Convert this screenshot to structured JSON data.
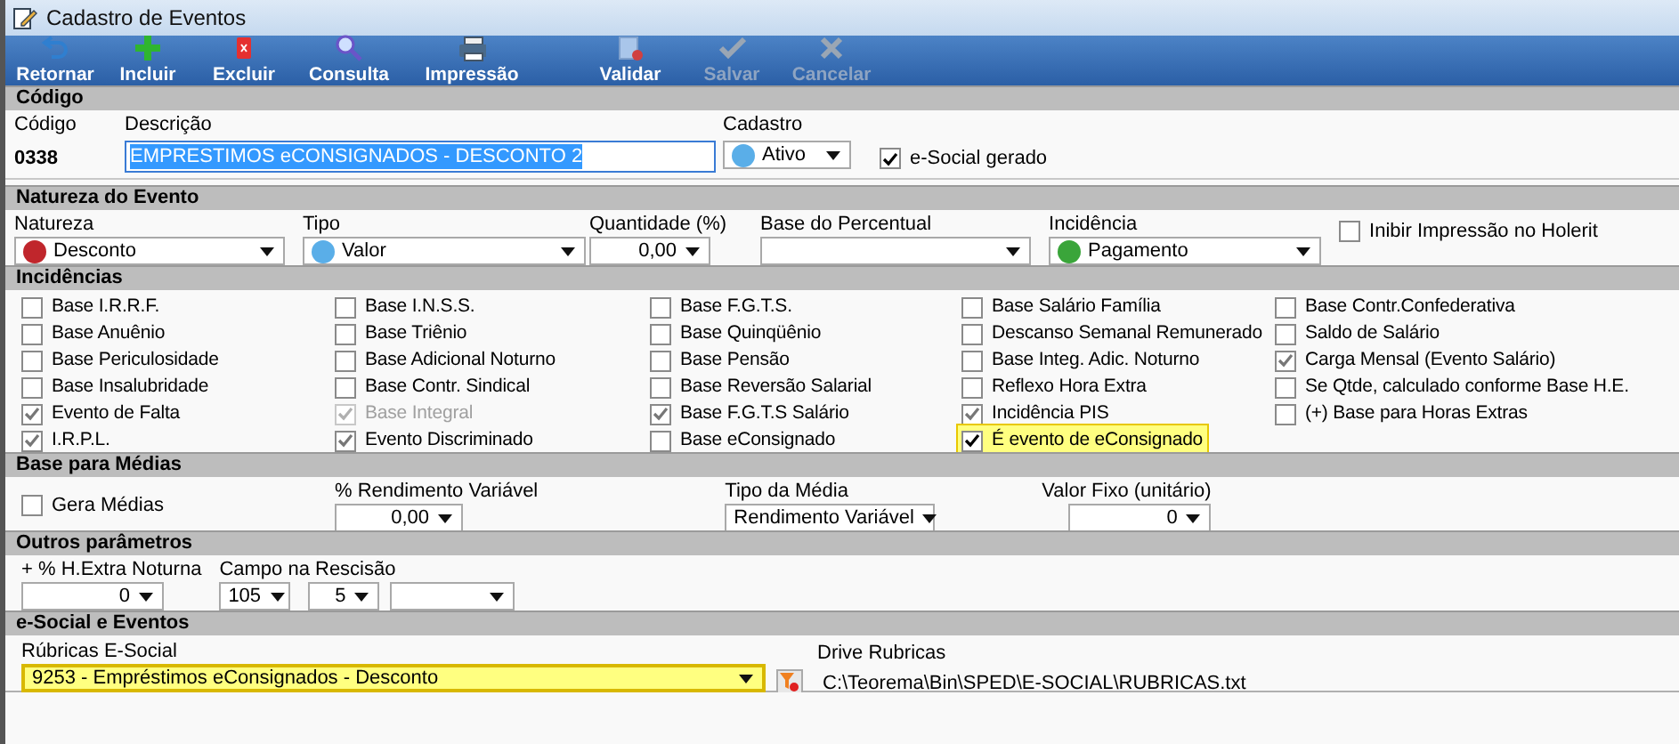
{
  "window": {
    "title": "Cadastro de Eventos"
  },
  "toolbar": [
    {
      "label": "Retornar",
      "kind": "return",
      "disabled": false
    },
    {
      "label": "Incluir",
      "kind": "add",
      "disabled": false
    },
    {
      "label": "Excluir",
      "kind": "delete",
      "disabled": false
    },
    {
      "label": "Consulta",
      "kind": "search",
      "disabled": false
    },
    {
      "label": "Impressão",
      "kind": "print",
      "disabled": false
    },
    {
      "label": "Validar",
      "kind": "validate",
      "disabled": false
    },
    {
      "label": "Salvar",
      "kind": "save",
      "disabled": true
    },
    {
      "label": "Cancelar",
      "kind": "cancel",
      "disabled": true
    }
  ],
  "codigo": {
    "header": "Código",
    "code_label": "Código",
    "code": "0338",
    "description_label": "Descrição",
    "description": "EMPRESTIMOS eCONSIGNADOS - DESCONTO 2",
    "cadastro_label": "Cadastro",
    "cadastro": {
      "value": "Ativo",
      "color": "#5aaee8"
    },
    "esocial_gerado": {
      "label": "e-Social gerado",
      "checked": true
    }
  },
  "natureza": {
    "header": "Natureza do Evento",
    "fields": [
      {
        "label": "Natureza",
        "value": "Desconto",
        "color": "#c0262c"
      },
      {
        "label": "Tipo",
        "value": "Valor",
        "color": "#5aaee8"
      },
      {
        "label": "Quantidade (%)",
        "value": "0,00"
      },
      {
        "label": "Base do Percentual"
      },
      {
        "label": "Incidência",
        "value": "Pagamento",
        "color": "#3aa53a"
      }
    ],
    "inibir": {
      "label": "Inibir Impressão no Holerit",
      "checked": false
    }
  },
  "incidencias": {
    "header": "Incidências",
    "items": [
      {
        "label": "Base I.R.R.F.",
        "checked": false,
        "disabled": false,
        "highlighted": false
      },
      {
        "label": "Base I.N.S.S.",
        "checked": false,
        "disabled": false,
        "highlighted": false
      },
      {
        "label": "Base F.G.T.S.",
        "checked": false,
        "disabled": false,
        "highlighted": false
      },
      {
        "label": "Base Salário Família",
        "checked": false,
        "disabled": false,
        "highlighted": false
      },
      {
        "label": "Base Contr.Confederativa",
        "checked": false,
        "disabled": false,
        "highlighted": false
      },
      {
        "label": "Base Anuênio",
        "checked": false,
        "disabled": false,
        "highlighted": false
      },
      {
        "label": "Base Triênio",
        "checked": false,
        "disabled": false,
        "highlighted": false
      },
      {
        "label": "Base Quinqüênio",
        "checked": false,
        "disabled": false,
        "highlighted": false
      },
      {
        "label": "Descanso Semanal Remunerado",
        "checked": false,
        "disabled": false,
        "highlighted": false
      },
      {
        "label": "Saldo de Salário",
        "checked": false,
        "disabled": false,
        "highlighted": false
      },
      {
        "label": "Base Periculosidade",
        "checked": false,
        "disabled": false,
        "highlighted": false
      },
      {
        "label": "Base Adicional Noturno",
        "checked": false,
        "disabled": false,
        "highlighted": false
      },
      {
        "label": "Base Pensão",
        "checked": false,
        "disabled": false,
        "highlighted": false
      },
      {
        "label": "Base Integ. Adic. Noturno",
        "checked": false,
        "disabled": false,
        "highlighted": false
      },
      {
        "label": "Carga Mensal (Evento Salário)",
        "checked": true,
        "disabled": false,
        "highlighted": false
      },
      {
        "label": "Base Insalubridade",
        "checked": false,
        "disabled": false,
        "highlighted": false
      },
      {
        "label": "Base Contr. Sindical",
        "checked": false,
        "disabled": false,
        "highlighted": false
      },
      {
        "label": "Base Reversão Salarial",
        "checked": false,
        "disabled": false,
        "highlighted": false
      },
      {
        "label": "Reflexo Hora Extra",
        "checked": false,
        "disabled": false,
        "highlighted": false
      },
      {
        "label": "Se Qtde, calculado conforme Base H.E.",
        "checked": false,
        "disabled": false,
        "highlighted": false
      },
      {
        "label": "Evento de Falta",
        "checked": true,
        "disabled": false,
        "highlighted": false
      },
      {
        "label": "Base Integral",
        "checked": true,
        "disabled": true,
        "highlighted": false
      },
      {
        "label": "Base F.G.T.S Salário",
        "checked": true,
        "disabled": false,
        "highlighted": false
      },
      {
        "label": "Incidência PIS",
        "checked": true,
        "disabled": false,
        "highlighted": false
      },
      {
        "label": "(+) Base para Horas Extras",
        "checked": false,
        "disabled": false,
        "highlighted": false
      },
      {
        "label": "I.R.P.L.",
        "checked": true,
        "disabled": false,
        "highlighted": false
      },
      {
        "label": "Evento Discriminado",
        "checked": true,
        "disabled": false,
        "highlighted": false
      },
      {
        "label": "Base eConsignado",
        "checked": false,
        "disabled": false,
        "highlighted": false
      },
      {
        "label": "É evento de eConsignado",
        "checked": true,
        "disabled": false,
        "highlighted": true
      }
    ]
  },
  "medias": {
    "header": "Base para Médias",
    "gera": {
      "label": "Gera Médias",
      "checked": false
    },
    "fields": [
      {
        "label": "% Rendimento Variável",
        "value": "0,00"
      },
      {
        "label": "Tipo da Média",
        "value": "Rendimento Variável"
      },
      {
        "label": "Valor Fixo (unitário)",
        "value": "0"
      }
    ]
  },
  "outros": {
    "header": "Outros parâmetros",
    "extra_label": "+ % H.Extra Noturna",
    "extra_value": "0",
    "rescisao_label": "Campo na Rescisão",
    "rescisao_fields": [
      {
        "kind": "number",
        "value": "105"
      },
      {
        "kind": "number",
        "value": "5"
      },
      {
        "kind": "blank"
      }
    ]
  },
  "esocial": {
    "header": "e-Social e Eventos",
    "rubricas_label": "Rúbricas E-Social",
    "rubricas": {
      "value": "9253 - Empréstimos eConsignados - Desconto",
      "highlighted": true
    },
    "drive_label": "Drive Rubricas",
    "drive_path": "C:\\Teorema\\Bin\\SPED\\E-SOCIAL\\RUBRICAS.txt"
  }
}
